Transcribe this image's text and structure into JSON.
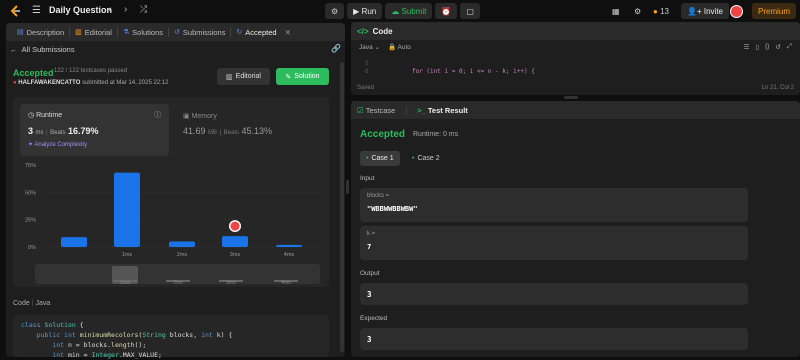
{
  "topbar": {
    "title": "Daily Question",
    "run_label": "Run",
    "submit_label": "Submit",
    "coins": "13",
    "invite_label": "Invite",
    "premium_label": "Premium"
  },
  "left_tabs": [
    {
      "label": "Description"
    },
    {
      "label": "Editorial"
    },
    {
      "label": "Solutions"
    },
    {
      "label": "Submissions"
    },
    {
      "label": "Accepted"
    }
  ],
  "submission": {
    "back_label": "All Submissions",
    "status": "Accepted",
    "passed": "122 / 122 testcases passed",
    "user": "HALFAWAKENCATTO",
    "submitted": "submitted at Mar 14, 2025 22:12",
    "editorial_btn": "Editorial",
    "solution_btn": "Solution"
  },
  "runtime": {
    "label": "Runtime",
    "value": "3",
    "unit": "ms",
    "beats_label": "Beats",
    "beats": "16.79%",
    "analyze": "Analyze Complexity"
  },
  "memory": {
    "label": "Memory",
    "value": "41.69",
    "unit": "MB",
    "beats_label": "Beats",
    "beats": "45.13%"
  },
  "chart_data": {
    "type": "bar",
    "categories": [
      "0ms",
      "1ms",
      "2ms",
      "3ms",
      "4ms"
    ],
    "x_labels": [
      "",
      "1ms",
      "2ms",
      "3ms",
      "4ms"
    ],
    "values": [
      9,
      68,
      5,
      10,
      2
    ],
    "yticks": [
      "75%",
      "50%",
      "25%",
      "0%"
    ],
    "ylim": [
      0,
      75
    ],
    "highlight_index": 3,
    "bar_color": "#1a73e8",
    "minimap_labels": [
      "1ms",
      "2ms",
      "3ms",
      "4ms"
    ]
  },
  "code": {
    "label": "Code",
    "lang": "Java",
    "lines": [
      "class Solution {",
      "    public int minimumRecolors(String blocks, int k) {",
      "        int n = blocks.length();",
      "        int min = Integer.MAX_VALUE;"
    ]
  },
  "editor": {
    "title": "Code",
    "lang": "Java",
    "mode": "Auto",
    "line5": "5",
    "line6": "6",
    "code6": "for (int i = 0; i <= n - k; i++) {",
    "saved": "Saved",
    "cursor": "Ln 21, Col 2"
  },
  "test": {
    "testcase_tab": "Testcase",
    "result_tab": "Test Result",
    "status": "Accepted",
    "runtime": "Runtime: 0 ms",
    "case1": "Case 1",
    "case2": "Case 2",
    "input_label": "Input",
    "blocks_key": "blocks =",
    "blocks_val": "\"WBBWWBBWBW\"",
    "k_key": "k =",
    "k_val": "7",
    "output_label": "Output",
    "output_val": "3",
    "expected_label": "Expected",
    "expected_val": "3"
  },
  "colors": {
    "accent_green": "#2cbb5d",
    "premium": "#ffa116",
    "bar": "#1a73e8"
  }
}
